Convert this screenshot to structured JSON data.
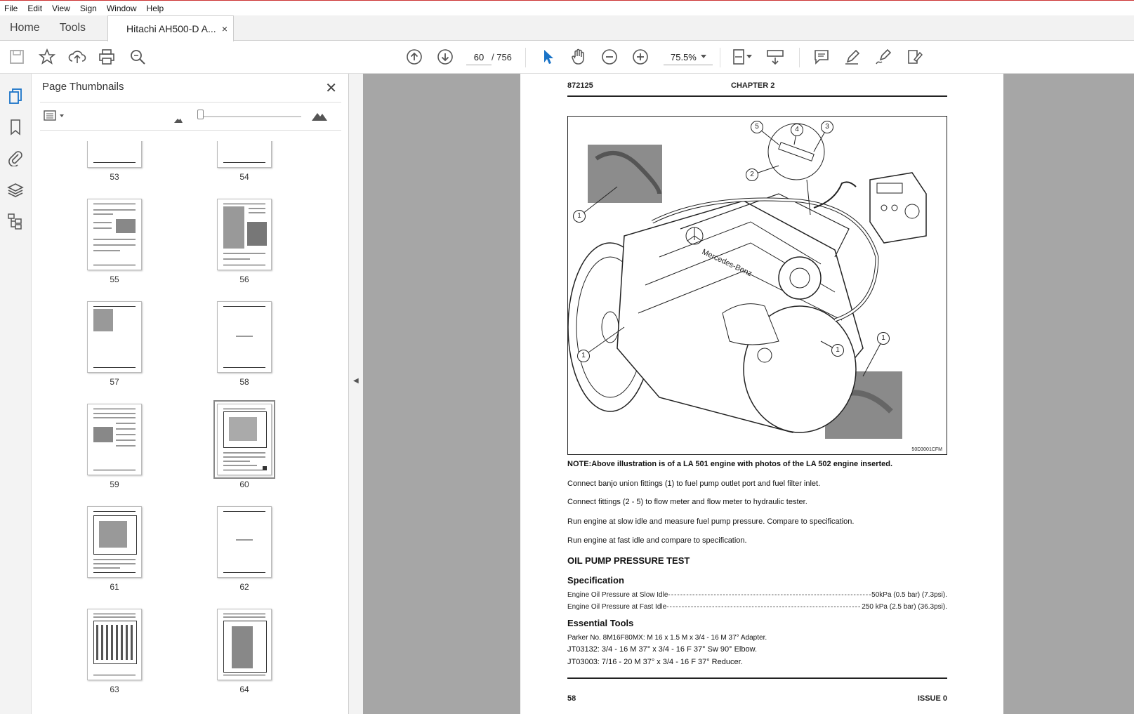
{
  "menu": [
    "File",
    "Edit",
    "View",
    "Sign",
    "Window",
    "Help"
  ],
  "tabs": {
    "home": "Home",
    "tools": "Tools",
    "document": "Hitachi AH500-D A...",
    "close": "×"
  },
  "toolbar": {
    "current_page": "60",
    "total_pages": "/ 756",
    "zoom": "75.5%"
  },
  "panel": {
    "title": "Page Thumbnails",
    "thumbnails": [
      {
        "num": "53"
      },
      {
        "num": "54"
      },
      {
        "num": "55"
      },
      {
        "num": "56"
      },
      {
        "num": "57"
      },
      {
        "num": "58"
      },
      {
        "num": "59"
      },
      {
        "num": "60"
      },
      {
        "num": "61"
      },
      {
        "num": "62"
      },
      {
        "num": "63"
      },
      {
        "num": "64"
      }
    ]
  },
  "document": {
    "header_left": "872125",
    "header_center": "CHAPTER 2",
    "figure_code": "50D3001CFM",
    "callouts": [
      "1",
      "2",
      "3",
      "4",
      "5"
    ],
    "note": "NOTE:Above illustration is of a LA 501 engine with photos of the LA 502 engine inserted.",
    "paragraphs": [
      "Connect banjo union fittings (1) to fuel pump outlet port and fuel filter inlet.",
      "Connect fittings (2 - 5) to flow meter and flow meter to hydraulic tester.",
      "Run engine at slow idle and measure fuel pump pressure. Compare to specification.",
      "Run engine at fast idle and compare to specification."
    ],
    "section_title": "OIL PUMP PRESSURE TEST",
    "spec_heading": "Specification",
    "specs": [
      {
        "label": "Engine Oil Pressure at Slow Idle",
        "value": "50kPa (0.5 bar) (7.3psi)."
      },
      {
        "label": "Engine Oil Pressure at Fast Idle",
        "value": "250 kPa (2.5 bar) (36.3psi)."
      }
    ],
    "tools_heading": "Essential Tools",
    "tools": [
      "Parker No. 8M16F80MX: M 16 x 1.5 M x 3/4 - 16 M 37° Adapter.",
      "JT03132: 3/4 - 16 M 37° x 3/4 - 16 F 37° Sw 90° Elbow.",
      "JT03003: 7/16 - 20 M 37° x 3/4 - 16 F 37° Reducer."
    ],
    "footer_left": "58",
    "footer_right": "ISSUE 0"
  }
}
